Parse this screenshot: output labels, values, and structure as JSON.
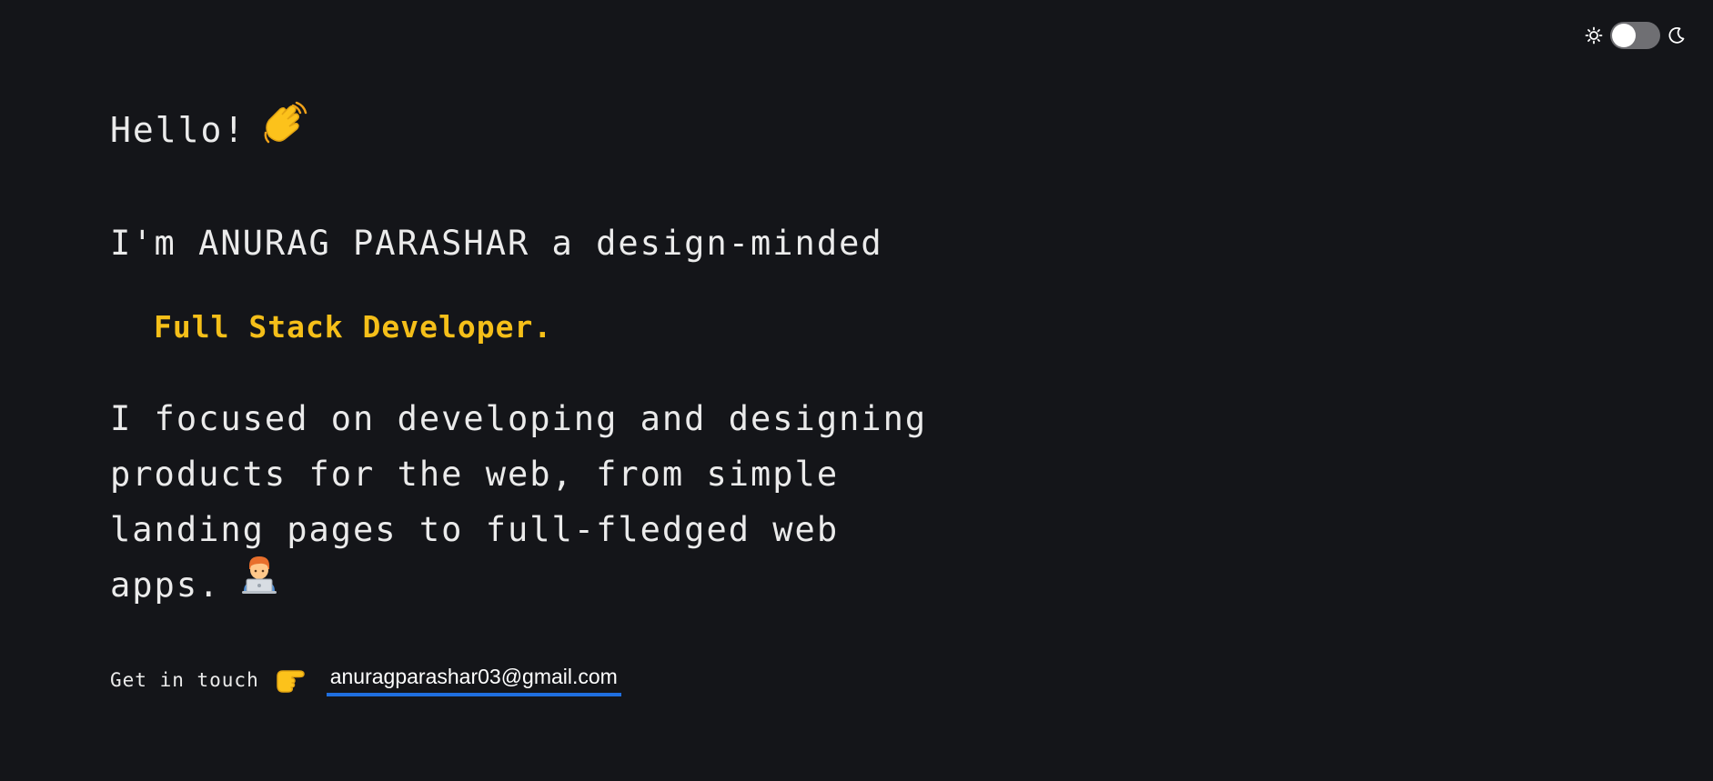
{
  "theme_toggle": {
    "light_icon": "sun-icon",
    "dark_icon": "moon-icon",
    "state": "off"
  },
  "hero": {
    "greeting": "Hello!",
    "greeting_icon": "waving-hand-icon",
    "intro": "I'm ANURAG PARASHAR a design-minded",
    "role": "Full Stack Developer.",
    "description_lines": [
      "I focused on developing and designing",
      "products for the web, from simple",
      "landing pages to full-fledged web",
      "apps."
    ],
    "description_icon": "technologist-laptop-icon"
  },
  "contact": {
    "label": "Get in touch",
    "pointer_icon": "pointing-right-hand-icon",
    "email": "anuragparashar03@gmail.com"
  },
  "colors": {
    "background": "#141519",
    "text": "#ebebeb",
    "accent": "#f5bf19",
    "link_underline": "#1f6fe0",
    "toggle_track": "#6f6f73"
  }
}
